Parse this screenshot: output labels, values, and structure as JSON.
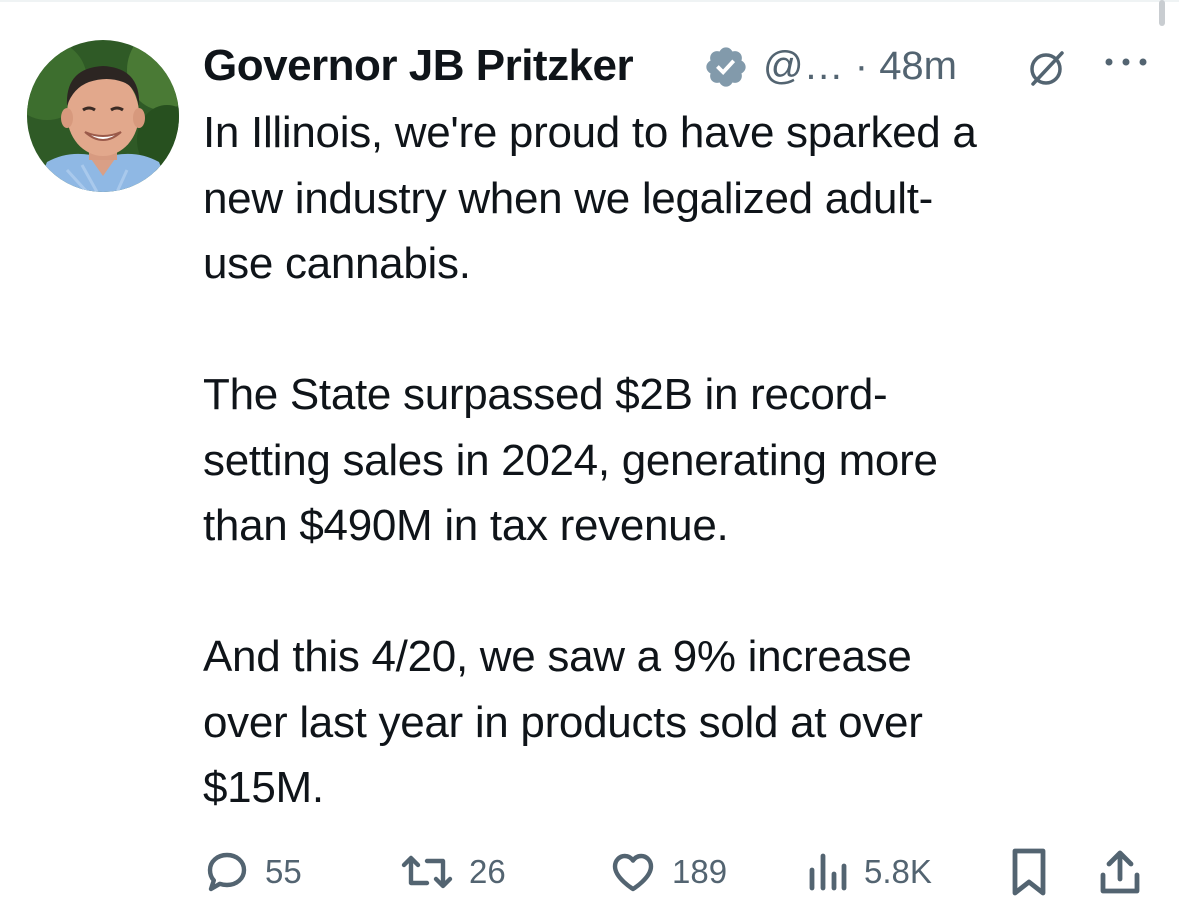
{
  "post": {
    "author_name": "Governor JB Pritzker",
    "handle": "@…",
    "separator": "·",
    "timestamp": "48m",
    "text": "In Illinois, we're proud to have sparked a\nnew industry when we legalized adult-\nuse cannabis.\n\nThe State surpassed $2B in record-\nsetting sales in 2024, generating more\nthan $490M in tax revenue.\n\nAnd this 4/20, we saw a 9% increase\nover last year in products sold at over\n$15M."
  },
  "actions": {
    "replies": "55",
    "reposts": "26",
    "likes": "189",
    "views": "5.8K"
  },
  "icons": {
    "verified": "verified-badge-icon",
    "grok": "grok-icon",
    "more": "more-icon",
    "reply": "reply-icon",
    "repost": "repost-icon",
    "like": "like-icon",
    "views": "views-icon",
    "bookmark": "bookmark-icon",
    "share": "share-icon"
  },
  "colors": {
    "text": "#0f1419",
    "secondary": "#536471",
    "verified_badge": "#829aab",
    "background": "#ffffff"
  }
}
